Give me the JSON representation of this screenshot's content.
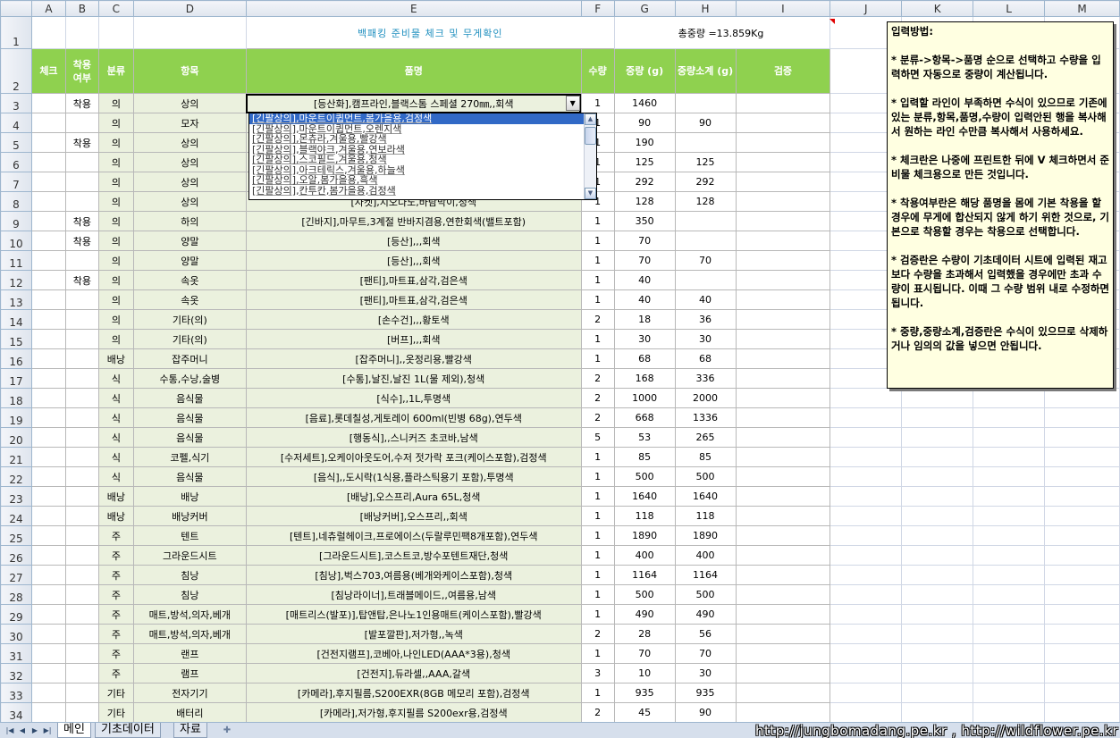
{
  "sheet": {
    "columns": [
      "A",
      "B",
      "C",
      "D",
      "E",
      "F",
      "G",
      "H",
      "I",
      "J",
      "K",
      "L",
      "M"
    ],
    "title": "백패킹 준비물 체크 및 무게확인",
    "total": "총중량 =13.859Kg",
    "headers": {
      "check": "체크",
      "wear": "착용 여부",
      "category": "분류",
      "item": "항목",
      "product": "품명",
      "qty": "수량",
      "weight": "중량 (g)",
      "subtotal": "중량소계 (g)",
      "verify": "검증"
    },
    "active_cell": "E3",
    "rows": [
      {
        "n": "3",
        "wear": "착용",
        "cat": "의",
        "item": "상의",
        "name": "[등산화],캠프라인,블랙스톰 스페셜 270㎜,,회색",
        "qty": "1",
        "w": "1460",
        "s": ""
      },
      {
        "n": "4",
        "wear": "",
        "cat": "의",
        "item": "모자",
        "name": "",
        "qty": "1",
        "w": "90",
        "s": "90"
      },
      {
        "n": "5",
        "wear": "착용",
        "cat": "의",
        "item": "상의",
        "name": "",
        "qty": "1",
        "w": "190",
        "s": ""
      },
      {
        "n": "6",
        "wear": "",
        "cat": "의",
        "item": "상의",
        "name": "",
        "qty": "1",
        "w": "125",
        "s": "125"
      },
      {
        "n": "7",
        "wear": "",
        "cat": "의",
        "item": "상의",
        "name": "",
        "qty": "1",
        "w": "292",
        "s": "292"
      },
      {
        "n": "8",
        "wear": "",
        "cat": "의",
        "item": "상의",
        "name": "[자켓],지오다노,바람막이,청색",
        "qty": "1",
        "w": "128",
        "s": "128"
      },
      {
        "n": "9",
        "wear": "착용",
        "cat": "의",
        "item": "하의",
        "name": "[긴바지],마무트,3계절 반바지겸용,연한회색(밸트포함)",
        "qty": "1",
        "w": "350",
        "s": ""
      },
      {
        "n": "10",
        "wear": "착용",
        "cat": "의",
        "item": "양말",
        "name": "[등산],,,회색",
        "qty": "1",
        "w": "70",
        "s": ""
      },
      {
        "n": "11",
        "wear": "",
        "cat": "의",
        "item": "양말",
        "name": "[등산],,,회색",
        "qty": "1",
        "w": "70",
        "s": "70"
      },
      {
        "n": "12",
        "wear": "착용",
        "cat": "의",
        "item": "속옷",
        "name": "[팬티],마트표,삼각,검은색",
        "qty": "1",
        "w": "40",
        "s": ""
      },
      {
        "n": "13",
        "wear": "",
        "cat": "의",
        "item": "속옷",
        "name": "[팬티],마트표,삼각,검은색",
        "qty": "1",
        "w": "40",
        "s": "40"
      },
      {
        "n": "14",
        "wear": "",
        "cat": "의",
        "item": "기타(의)",
        "name": "[손수건],,,황토색",
        "qty": "2",
        "w": "18",
        "s": "36"
      },
      {
        "n": "15",
        "wear": "",
        "cat": "의",
        "item": "기타(의)",
        "name": "[버프],,,회색",
        "qty": "1",
        "w": "30",
        "s": "30"
      },
      {
        "n": "16",
        "wear": "",
        "cat": "배낭",
        "item": "잡주머니",
        "name": "[잡주머니],,옷정리용,빨강색",
        "qty": "1",
        "w": "68",
        "s": "68"
      },
      {
        "n": "17",
        "wear": "",
        "cat": "식",
        "item": "수통,수낭,술병",
        "name": "[수통],날진,날진 1L(물 제외),청색",
        "qty": "2",
        "w": "168",
        "s": "336"
      },
      {
        "n": "18",
        "wear": "",
        "cat": "식",
        "item": "음식물",
        "name": "[식수],,1L,투명색",
        "qty": "2",
        "w": "1000",
        "s": "2000"
      },
      {
        "n": "19",
        "wear": "",
        "cat": "식",
        "item": "음식물",
        "name": "[음료],롯데칠성,게토레이 600ml(빈병 68g),연두색",
        "qty": "2",
        "w": "668",
        "s": "1336"
      },
      {
        "n": "20",
        "wear": "",
        "cat": "식",
        "item": "음식물",
        "name": "[행동식],,스니커즈 초코바,남색",
        "qty": "5",
        "w": "53",
        "s": "265"
      },
      {
        "n": "21",
        "wear": "",
        "cat": "식",
        "item": "코펠,식기",
        "name": "[수저세트],오케이아웃도어,수저 젓가락 포크(케이스포함),검정색",
        "qty": "1",
        "w": "85",
        "s": "85"
      },
      {
        "n": "22",
        "wear": "",
        "cat": "식",
        "item": "음식물",
        "name": "[음식],,도시락(1식용,플라스틱용기 포함),투명색",
        "qty": "1",
        "w": "500",
        "s": "500"
      },
      {
        "n": "23",
        "wear": "",
        "cat": "배낭",
        "item": "배낭",
        "name": "[배낭],오스프리,Aura 65L,청색",
        "qty": "1",
        "w": "1640",
        "s": "1640"
      },
      {
        "n": "24",
        "wear": "",
        "cat": "배낭",
        "item": "배낭커버",
        "name": "[배낭커버],오스프리,,회색",
        "qty": "1",
        "w": "118",
        "s": "118"
      },
      {
        "n": "25",
        "wear": "",
        "cat": "주",
        "item": "텐트",
        "name": "[텐트],네츄럴헤이크,프로에이스(두랄루민팩8개포함),연두색",
        "qty": "1",
        "w": "1890",
        "s": "1890"
      },
      {
        "n": "26",
        "wear": "",
        "cat": "주",
        "item": "그라운드시트",
        "name": "[그라운드시트],코스트코,방수포텐트재단,청색",
        "qty": "1",
        "w": "400",
        "s": "400"
      },
      {
        "n": "27",
        "wear": "",
        "cat": "주",
        "item": "침낭",
        "name": "[침낭],벅스703,여름용(베개와케이스포함),청색",
        "qty": "1",
        "w": "1164",
        "s": "1164"
      },
      {
        "n": "28",
        "wear": "",
        "cat": "주",
        "item": "침낭",
        "name": "[침낭라이너],트래블메이드,,여름용,남색",
        "qty": "1",
        "w": "500",
        "s": "500"
      },
      {
        "n": "29",
        "wear": "",
        "cat": "주",
        "item": "매트,방석,의자,베개",
        "name": "[매트리스(발포)],탑앤탑,은나노1인용매트(케이스포함),빨강색",
        "qty": "1",
        "w": "490",
        "s": "490"
      },
      {
        "n": "30",
        "wear": "",
        "cat": "주",
        "item": "매트,방석,의자,베개",
        "name": "[발포깔판],저가형,,녹색",
        "qty": "2",
        "w": "28",
        "s": "56"
      },
      {
        "n": "31",
        "wear": "",
        "cat": "주",
        "item": "랜프",
        "name": "[건전지램프],코베아,나인LED(AAA*3용),청색",
        "qty": "1",
        "w": "70",
        "s": "70"
      },
      {
        "n": "32",
        "wear": "",
        "cat": "주",
        "item": "램프",
        "name": "[건전지],듀라셀,,AAA,갈색",
        "qty": "3",
        "w": "10",
        "s": "30"
      },
      {
        "n": "33",
        "wear": "",
        "cat": "기타",
        "item": "전자기기",
        "name": "[카메라],후지필름,S200EXR(8GB 메모리 포함),검정색",
        "qty": "1",
        "w": "935",
        "s": "935"
      },
      {
        "n": "34",
        "wear": "",
        "cat": "기타",
        "item": "배터리",
        "name": "[카메라],저가형,후지필름 S200exr용,검정색",
        "qty": "2",
        "w": "45",
        "s": "90"
      }
    ]
  },
  "dropdown": {
    "options": [
      "[긴팔상의],마운트이큅먼트,봄가을용,검정색",
      "[긴팔상의],마운트이큅먼트,오렌지색",
      "[긴팔상의],몬츄라,겨울용,빨강색",
      "[긴팔상의],블랙야크,겨울용,연보라색",
      "[긴팔상의],스코필드,겨울용,청색",
      "[긴팔상의],아크테릭스,겨울용,하늘색",
      "[긴팔상의],오알,봄가을용,흑색",
      "[긴팔상의],칸투칸,봄가을용,검정색"
    ],
    "selected_index": 0
  },
  "note": "입력방법:\n\n* 분류->항목->품명 순으로 선택하고 수량을 입력하면 자동으로 중량이 계산됩니다.\n\n* 입력할 라인이 부족하면 수식이 있으므로 기존에 있는 분류,항목,품명,수량이 입력안된 행을 복사해서 원하는 라인 수만큼 복사해서 사용하세요.\n\n* 체크란은 나중에 프린트한 뒤에 V 체크하면서 준비물 체크용으로 만든 것입니다.\n\n* 착용여부란은 해당 품명을 몸에 기본 착용을 할경우에 무게에 합산되지 않게 하기 위한 것으로, 기본으로 착용할 경우는 착용으로 선택합니다.\n\n* 검증란은 수량이 기초데이터 시트에 입력된 재고보다 수량을 초과해서 입력했을 경우에만 초과 수량이 표시됩니다. 이때 그 수량 범위 내로 수정하면 됩니다.\n\n* 중량,중량소계,검증란은 수식이 있으므로 삭제하거나 임의의 값을 넣으면 안됩니다.",
  "tabs": [
    "메인",
    "기초데이터",
    "자료"
  ],
  "footer_url": "http://jungbomadang.pe.kr , http://wildflower.pe.kr",
  "colors": {
    "header_green": "#8fd14f",
    "cell_fill": "#ebf1de",
    "title_blue": "#1f8fbf",
    "selection": "#3169c6",
    "note_bg": "#ffffe1"
  }
}
